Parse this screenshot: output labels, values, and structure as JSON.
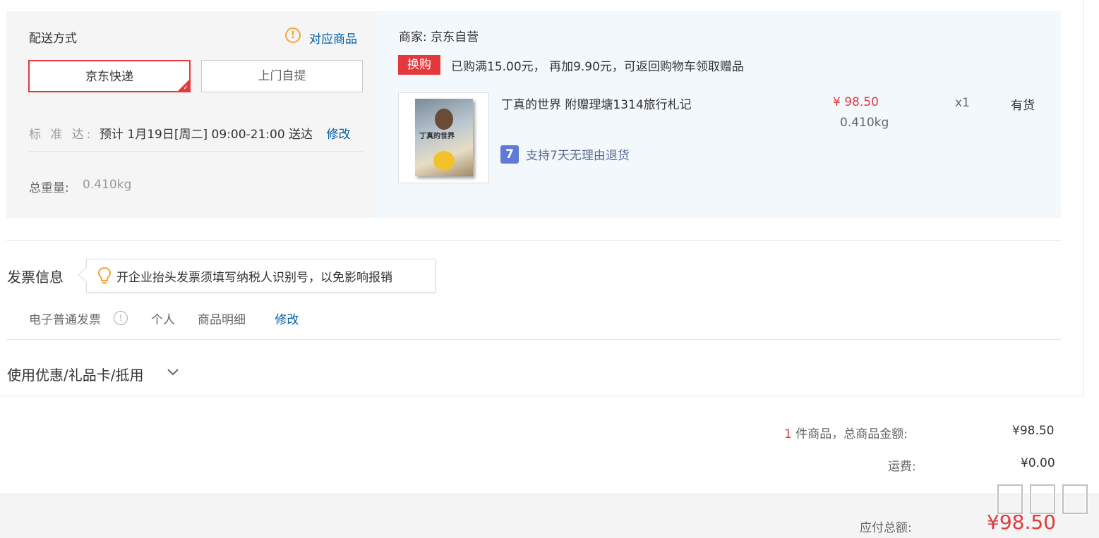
{
  "shipping": {
    "title": "配送方式",
    "match_goods_link": "对应商品",
    "options": [
      "京东快递",
      "上门自提"
    ],
    "selected_option": "京东快递",
    "standard_label": "标 准 达:",
    "standard_value": "预计 1月19日[周二] 09:00-21:00 送达",
    "modify_label": "修改",
    "total_weight_label": "总重量:",
    "total_weight_value": "0.410kg"
  },
  "goods": {
    "merchant": "商家: 京东自营",
    "swap_badge": "换购",
    "promo_text": "已购满15.00元， 再加9.90元，可返回购物车领取赠品",
    "item": {
      "name": "丁真的世界 附赠理塘1314旅行札记",
      "price": "¥ 98.50",
      "weight": "0.410kg",
      "quantity": "x1",
      "stock": "有货",
      "return_policy": "支持7天无理由退货",
      "return_icon_text": "7"
    }
  },
  "invoice": {
    "title": "发票信息",
    "tip": "开企业抬头发票须填写纳税人识别号，以免影响报销",
    "type": "电子普通发票",
    "info_icon_text": "!",
    "holder": "个人",
    "content": "商品明细",
    "modify_label": "修改"
  },
  "coupons": {
    "title": "使用优惠/礼品卡/抵用"
  },
  "summary": {
    "count": "1",
    "items_label": " 件商品，总商品金额:",
    "items_total": "¥98.50",
    "freight_label": "运费:",
    "freight_value": "¥0.00",
    "payable_label": "应付总额:",
    "payable_value": "¥98.50"
  },
  "colors": {
    "brand_red": "#e4393c",
    "link_blue": "#005ea7",
    "warning_orange": "#f3a33b",
    "goods_panel_bg": "#f3f8fc"
  },
  "icons": [
    "warning-icon",
    "check-corner-icon",
    "seven-day-return-icon",
    "lightbulb-icon",
    "info-icon",
    "chevron-down-icon"
  ]
}
